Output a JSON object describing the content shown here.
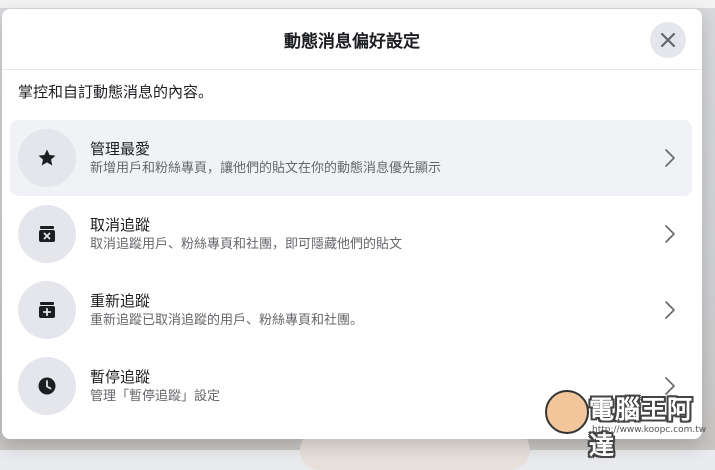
{
  "dialog": {
    "title": "動態消息偏好設定",
    "subtitle": "掌控和自訂動態消息的內容。"
  },
  "items": [
    {
      "icon": "star-icon",
      "title": "管理最愛",
      "description": "新增用戶和粉絲專頁，讓他們的貼文在你的動態消息優先顯示",
      "active": true
    },
    {
      "icon": "unfollow-box-icon",
      "title": "取消追蹤",
      "description": "取消追蹤用戶、粉絲專頁和社團，即可隱藏他們的貼文",
      "active": false
    },
    {
      "icon": "refollow-box-icon",
      "title": "重新追蹤",
      "description": "重新追蹤已取消追蹤的用戶、粉絲專頁和社團。",
      "active": false
    },
    {
      "icon": "clock-icon",
      "title": "暫停追蹤",
      "description": "管理「暫停追蹤」設定",
      "active": false
    }
  ],
  "watermark": {
    "text": "電腦王阿達",
    "url": "http://www.koopc.com.tw"
  },
  "colors": {
    "surface": "#ffffff",
    "icon_bg": "#e4e6eb",
    "hover_bg": "#f0f2f5",
    "primary_text": "#1c1e21",
    "secondary_text": "#65676b"
  }
}
